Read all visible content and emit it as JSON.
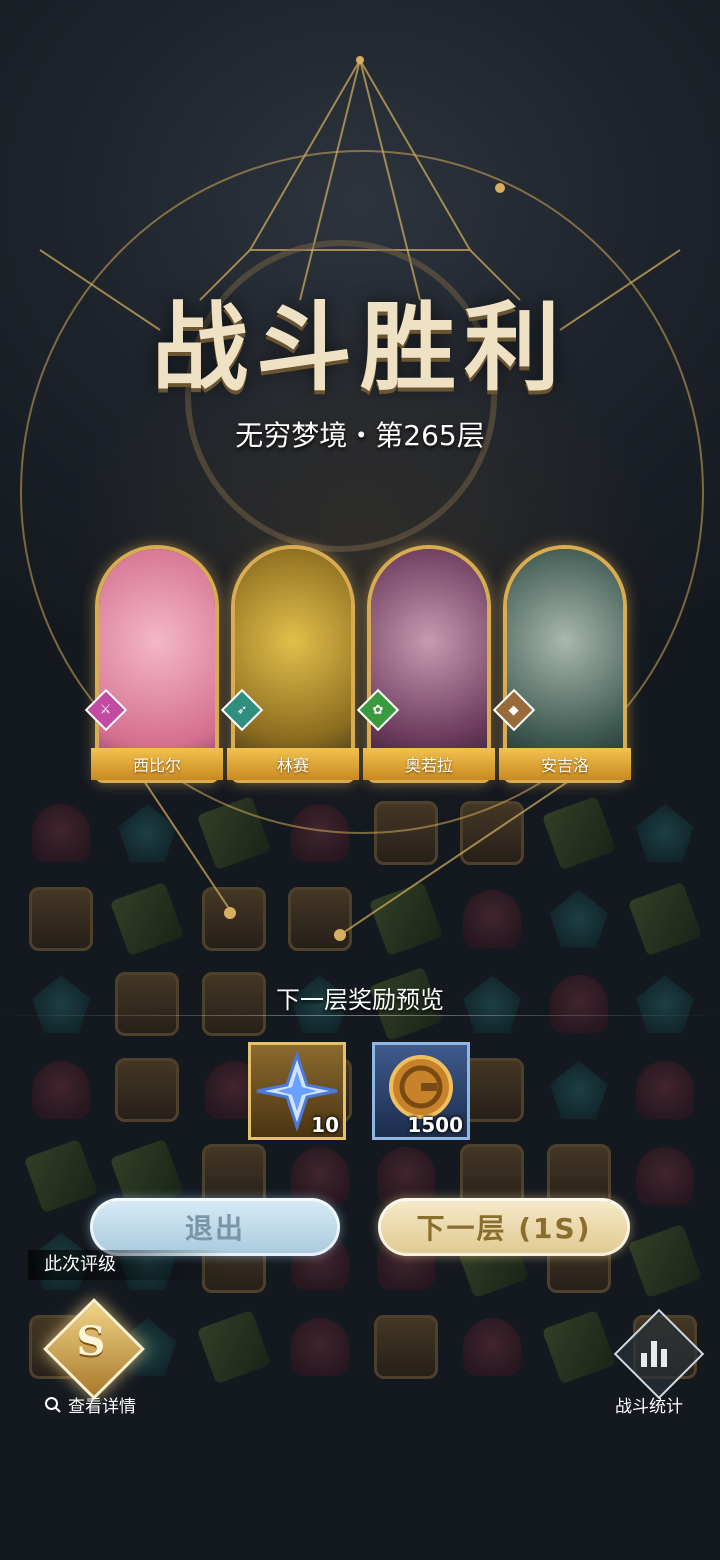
{
  "result": {
    "title": "战斗胜利",
    "subtitle": "无穷梦境・第265层"
  },
  "heroes": [
    {
      "name": "西比尔",
      "class_color": "#c24aa2",
      "class_icon": "sword-icon",
      "portrait_colors": [
        "#f3b7c8",
        "#d56f8f"
      ]
    },
    {
      "name": "林赛",
      "class_color": "#2f8e7e",
      "class_icon": "bow-icon",
      "portrait_colors": [
        "#c9a233",
        "#5a4a1c"
      ]
    },
    {
      "name": "奥若拉",
      "class_color": "#3a9b3e",
      "class_icon": "leaf-icon",
      "portrait_colors": [
        "#9a6aa0",
        "#3c2740"
      ]
    },
    {
      "name": "安吉洛",
      "class_color": "#9a6b3a",
      "class_icon": "shield-icon",
      "portrait_colors": [
        "#7a9a8a",
        "#2b3a3a"
      ]
    }
  ],
  "rewards": {
    "title": "下一层奖励预览",
    "items": [
      {
        "name": "star-crystal",
        "icon": "star-crystal-icon",
        "quantity": "10"
      },
      {
        "name": "gold-coin",
        "icon": "gold-coin-icon",
        "quantity": "1500"
      }
    ]
  },
  "buttons": {
    "exit": "退出",
    "next": "下一层 (1S)"
  },
  "rating": {
    "label": "此次评级",
    "grade": "S",
    "details": "查看详情"
  },
  "stats": {
    "label": "战斗统计"
  },
  "colors": {
    "gold_accent": "#d9ac52",
    "title_text": "#efe2c4"
  }
}
